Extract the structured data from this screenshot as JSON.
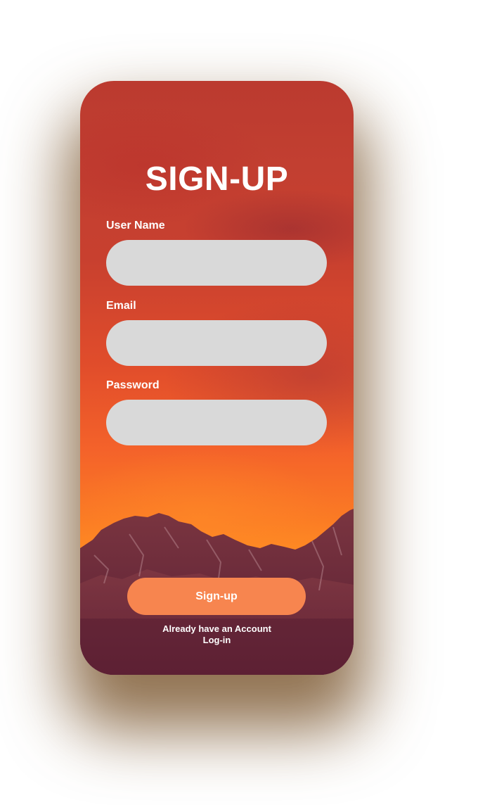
{
  "screen": {
    "title": "SIGN-UP"
  },
  "form": {
    "username": {
      "label": "User Name",
      "value": "",
      "placeholder": ""
    },
    "email": {
      "label": "Email",
      "value": "",
      "placeholder": ""
    },
    "password": {
      "label": "Password",
      "value": "",
      "placeholder": ""
    }
  },
  "actions": {
    "signup_label": "Sign-up"
  },
  "footer": {
    "prompt": "Already have an Account",
    "login_label": "Log-in"
  },
  "colors": {
    "field_background": "#d9d9d9",
    "button_background": "#f7854f",
    "text": "#ffffff"
  }
}
